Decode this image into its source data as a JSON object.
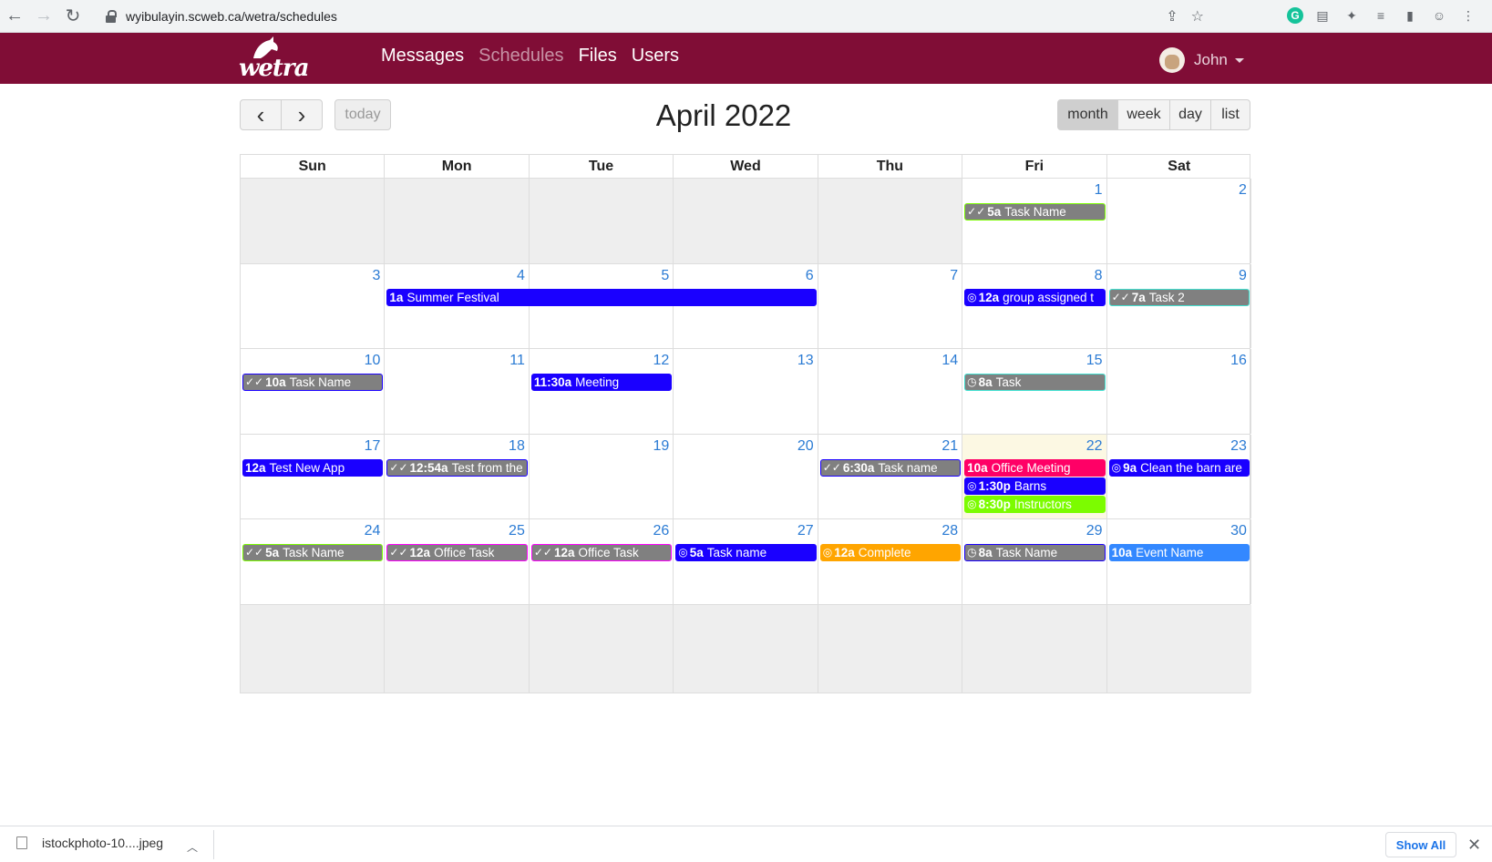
{
  "browser": {
    "url": "wyibulayin.scweb.ca/wetra/schedules"
  },
  "header": {
    "logo_text": "wetra",
    "nav": [
      {
        "label": "Messages",
        "active": false
      },
      {
        "label": "Schedules",
        "active": true
      },
      {
        "label": "Files",
        "active": false
      },
      {
        "label": "Users",
        "active": false
      }
    ],
    "user_name": "John"
  },
  "toolbar": {
    "prev": "‹",
    "next": "›",
    "today": "today",
    "title": "April 2022",
    "views": [
      "month",
      "week",
      "day",
      "list"
    ],
    "active_view": "month"
  },
  "calendar": {
    "weekdays": [
      "Sun",
      "Mon",
      "Tue",
      "Wed",
      "Thu",
      "Fri",
      "Sat"
    ],
    "weeks": [
      [
        null,
        null,
        null,
        null,
        null,
        "1",
        "2"
      ],
      [
        "3",
        "4",
        "5",
        "6",
        "7",
        "8",
        "9"
      ],
      [
        "10",
        "11",
        "12",
        "13",
        "14",
        "15",
        "16"
      ],
      [
        "17",
        "18",
        "19",
        "20",
        "21",
        "22",
        "23"
      ],
      [
        "24",
        "25",
        "26",
        "27",
        "28",
        "29",
        "30"
      ],
      [
        null,
        null,
        null,
        null,
        null,
        null,
        null
      ]
    ],
    "today": {
      "week": 3,
      "day": 5
    },
    "events": [
      {
        "week": 0,
        "day": 5,
        "span": 1,
        "row": 0,
        "icon": "check-all",
        "time": "5a",
        "title": "Task Name",
        "bg": "#808080",
        "border": "#7cfc00"
      },
      {
        "week": 1,
        "day": 1,
        "span": 3,
        "row": 0,
        "icon": "",
        "time": "1a",
        "title": "Summer Festival",
        "bg": "#1a00ff",
        "border": "#1a00ff"
      },
      {
        "week": 1,
        "day": 5,
        "span": 1,
        "row": 0,
        "icon": "check-circle",
        "time": "12a",
        "title": "group assigned t",
        "bg": "#1a00ff",
        "border": "#1a00ff"
      },
      {
        "week": 1,
        "day": 6,
        "span": 1,
        "row": 0,
        "icon": "check-all",
        "time": "7a",
        "title": "Task 2",
        "bg": "#808080",
        "border": "#40e0d0"
      },
      {
        "week": 2,
        "day": 0,
        "span": 1,
        "row": 0,
        "icon": "check-all",
        "time": "10a",
        "title": "Task Name",
        "bg": "#808080",
        "border": "#1a00ff"
      },
      {
        "week": 2,
        "day": 2,
        "span": 1,
        "row": 0,
        "icon": "",
        "time": "11:30a",
        "title": "Meeting",
        "bg": "#1a00ff",
        "border": "#1a00ff"
      },
      {
        "week": 2,
        "day": 5,
        "span": 1,
        "row": 0,
        "icon": "clock",
        "time": "8a",
        "title": "Task",
        "bg": "#808080",
        "border": "#40e0d0"
      },
      {
        "week": 3,
        "day": 0,
        "span": 1,
        "row": 0,
        "icon": "",
        "time": "12a",
        "title": "Test New App",
        "bg": "#1a00ff",
        "border": "#1a00ff"
      },
      {
        "week": 3,
        "day": 1,
        "span": 1,
        "row": 0,
        "icon": "check-all",
        "time": "12:54a",
        "title": "Test from the",
        "bg": "#808080",
        "border": "#1a00ff"
      },
      {
        "week": 3,
        "day": 4,
        "span": 1,
        "row": 0,
        "icon": "check-all",
        "time": "6:30a",
        "title": "Task name",
        "bg": "#808080",
        "border": "#1a00ff"
      },
      {
        "week": 3,
        "day": 5,
        "span": 1,
        "row": 0,
        "icon": "",
        "time": "10a",
        "title": "Office Meeting",
        "bg": "#ff0066",
        "border": "#ff0066"
      },
      {
        "week": 3,
        "day": 5,
        "span": 1,
        "row": 1,
        "icon": "check-circle",
        "time": "1:30p",
        "title": "Barns",
        "bg": "#1a00ff",
        "border": "#1a00ff"
      },
      {
        "week": 3,
        "day": 5,
        "span": 1,
        "row": 2,
        "icon": "check-circle",
        "time": "8:30p",
        "title": "Instructors",
        "bg": "#7cfc00",
        "border": "#7cfc00"
      },
      {
        "week": 3,
        "day": 6,
        "span": 1,
        "row": 0,
        "icon": "check-circle",
        "time": "9a",
        "title": "Clean the barn are",
        "bg": "#1a00ff",
        "border": "#1a00ff"
      },
      {
        "week": 4,
        "day": 0,
        "span": 1,
        "row": 0,
        "icon": "check-all",
        "time": "5a",
        "title": "Task Name",
        "bg": "#808080",
        "border": "#7cfc00"
      },
      {
        "week": 4,
        "day": 1,
        "span": 1,
        "row": 0,
        "icon": "check-all",
        "time": "12a",
        "title": "Office Task",
        "bg": "#808080",
        "border": "#ff00ff"
      },
      {
        "week": 4,
        "day": 2,
        "span": 1,
        "row": 0,
        "icon": "check-all",
        "time": "12a",
        "title": "Office Task",
        "bg": "#808080",
        "border": "#ff00ff"
      },
      {
        "week": 4,
        "day": 3,
        "span": 1,
        "row": 0,
        "icon": "check-circle",
        "time": "5a",
        "title": "Task name",
        "bg": "#1a00ff",
        "border": "#1a00ff"
      },
      {
        "week": 4,
        "day": 4,
        "span": 1,
        "row": 0,
        "icon": "check-circle",
        "time": "12a",
        "title": "Complete",
        "bg": "#ffa500",
        "border": "#ffa500"
      },
      {
        "week": 4,
        "day": 5,
        "span": 1,
        "row": 0,
        "icon": "clock",
        "time": "8a",
        "title": "Task Name",
        "bg": "#808080",
        "border": "#1a00ff"
      },
      {
        "week": 4,
        "day": 6,
        "span": 1,
        "row": 0,
        "icon": "",
        "time": "10a",
        "title": "Event Name",
        "bg": "#3388ff",
        "border": "#3388ff"
      }
    ]
  },
  "downloads": {
    "file_name": "istockphoto-10....jpeg",
    "show_all": "Show All"
  }
}
